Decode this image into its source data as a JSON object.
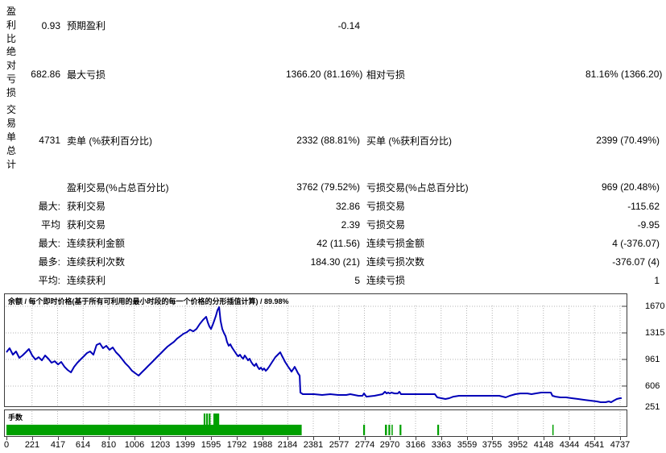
{
  "stats_table": {
    "rows": [
      {
        "group": "盈利比",
        "col2": "0.93",
        "col3": "预期盈利",
        "col4": "-0.14",
        "col5": "",
        "col6": ""
      },
      {
        "group": "绝对亏损",
        "col2": "682.86",
        "col3": "最大亏损",
        "col4": "1366.20 (81.16%)",
        "col5": "相对亏损",
        "col6": "81.16% (1366.20)"
      },
      {
        "group": "交易单总计",
        "col2": "4731",
        "col3": "卖单 (%获利百分比)",
        "col4": "2332 (88.81%)",
        "col5": "买单 (%获利百分比)",
        "col6": "2399 (70.49%)"
      },
      {
        "group": "",
        "col2": "",
        "col3": "盈利交易(%占总百分比)",
        "col4": "3762 (79.52%)",
        "col5": "亏损交易(%占总百分比)",
        "col6": "969 (20.48%)"
      },
      {
        "group": "",
        "col2": "最大:",
        "col3": "获利交易",
        "col4": "32.86",
        "col5": "亏损交易",
        "col6": "-115.62"
      },
      {
        "group": "",
        "col2": "平均",
        "col3": "获利交易",
        "col4": "2.39",
        "col5": "亏损交易",
        "col6": "-9.95"
      },
      {
        "group": "",
        "col2": "最大:",
        "col3": "连续获利金额",
        "col4": "42 (11.56)",
        "col5": "连续亏损金额",
        "col6": "4 (-376.07)"
      },
      {
        "group": "",
        "col2": "最多:",
        "col3": "连续获利次数",
        "col4": "184.30 (21)",
        "col5": "连续亏损次数",
        "col6": "-376.07 (4)"
      },
      {
        "group": "",
        "col2": "平均:",
        "col3": "连续获利",
        "col4": "5",
        "col5": "连续亏损",
        "col6": "1"
      }
    ]
  },
  "chart_data": [
    {
      "type": "line",
      "title": "余额 / 每个即时价格(基于所有可利用的最小时段的每一个价格的分形插值计算) / 89.98%",
      "line_color": "#0000b8",
      "grid": "dashed",
      "legend_position": "none",
      "xlim": [
        0,
        4860
      ],
      "ylim": [
        336,
        1842
      ],
      "x_ticks": [
        0,
        221,
        417,
        614,
        810,
        1006,
        1203,
        1399,
        1595,
        1792,
        1988,
        2184,
        2381,
        2577,
        2774,
        2970,
        3166,
        3363,
        3559,
        3755,
        3952,
        4148,
        4344,
        4541,
        4737
      ],
      "y_ticks": [
        1670,
        1315,
        961,
        606,
        251
      ],
      "series": [
        {
          "name": "余额",
          "points": [
            [
              0,
              1057
            ],
            [
              25,
              1111
            ],
            [
              51,
              1025
            ],
            [
              76,
              1068
            ],
            [
              102,
              982
            ],
            [
              127,
              1014
            ],
            [
              153,
              1057
            ],
            [
              178,
              1100
            ],
            [
              204,
              1014
            ],
            [
              229,
              960
            ],
            [
              255,
              992
            ],
            [
              280,
              949
            ],
            [
              306,
              1014
            ],
            [
              331,
              971
            ],
            [
              357,
              917
            ],
            [
              382,
              938
            ],
            [
              408,
              895
            ],
            [
              433,
              928
            ],
            [
              459,
              863
            ],
            [
              484,
              820
            ],
            [
              510,
              788
            ],
            [
              535,
              863
            ],
            [
              561,
              917
            ],
            [
              586,
              960
            ],
            [
              612,
              1003
            ],
            [
              637,
              1046
            ],
            [
              662,
              1068
            ],
            [
              688,
              1025
            ],
            [
              713,
              1154
            ],
            [
              739,
              1175
            ],
            [
              764,
              1111
            ],
            [
              790,
              1143
            ],
            [
              815,
              1089
            ],
            [
              841,
              1121
            ],
            [
              866,
              1057
            ],
            [
              892,
              1014
            ],
            [
              917,
              960
            ],
            [
              943,
              906
            ],
            [
              968,
              863
            ],
            [
              994,
              809
            ],
            [
              1019,
              777
            ],
            [
              1045,
              745
            ],
            [
              1070,
              788
            ],
            [
              1096,
              831
            ],
            [
              1121,
              874
            ],
            [
              1147,
              917
            ],
            [
              1172,
              960
            ],
            [
              1197,
              1003
            ],
            [
              1223,
              1046
            ],
            [
              1248,
              1089
            ],
            [
              1274,
              1132
            ],
            [
              1299,
              1164
            ],
            [
              1325,
              1196
            ],
            [
              1350,
              1239
            ],
            [
              1376,
              1272
            ],
            [
              1401,
              1304
            ],
            [
              1427,
              1325
            ],
            [
              1452,
              1358
            ],
            [
              1478,
              1336
            ],
            [
              1503,
              1368
            ],
            [
              1529,
              1433
            ],
            [
              1554,
              1487
            ],
            [
              1580,
              1530
            ],
            [
              1593,
              1454
            ],
            [
              1605,
              1401
            ],
            [
              1618,
              1368
            ],
            [
              1631,
              1422
            ],
            [
              1643,
              1475
            ],
            [
              1656,
              1540
            ],
            [
              1669,
              1616
            ],
            [
              1682,
              1659
            ],
            [
              1694,
              1475
            ],
            [
              1707,
              1368
            ],
            [
              1720,
              1315
            ],
            [
              1733,
              1272
            ],
            [
              1745,
              1196
            ],
            [
              1758,
              1143
            ],
            [
              1771,
              1164
            ],
            [
              1784,
              1121
            ],
            [
              1796,
              1089
            ],
            [
              1809,
              1057
            ],
            [
              1822,
              1025
            ],
            [
              1834,
              1003
            ],
            [
              1847,
              1025
            ],
            [
              1860,
              992
            ],
            [
              1873,
              971
            ],
            [
              1885,
              1014
            ],
            [
              1898,
              982
            ],
            [
              1911,
              949
            ],
            [
              1924,
              971
            ],
            [
              1936,
              928
            ],
            [
              1949,
              895
            ],
            [
              1962,
              874
            ],
            [
              1975,
              906
            ],
            [
              1987,
              863
            ],
            [
              2000,
              831
            ],
            [
              2013,
              852
            ],
            [
              2026,
              820
            ],
            [
              2038,
              842
            ],
            [
              2051,
              809
            ],
            [
              2064,
              831
            ],
            [
              2077,
              863
            ],
            [
              2089,
              895
            ],
            [
              2102,
              928
            ],
            [
              2115,
              960
            ],
            [
              2127,
              992
            ],
            [
              2140,
              1014
            ],
            [
              2153,
              1036
            ],
            [
              2166,
              1057
            ],
            [
              2178,
              1014
            ],
            [
              2191,
              971
            ],
            [
              2204,
              928
            ],
            [
              2217,
              895
            ],
            [
              2229,
              863
            ],
            [
              2242,
              831
            ],
            [
              2255,
              798
            ],
            [
              2268,
              831
            ],
            [
              2280,
              863
            ],
            [
              2293,
              820
            ],
            [
              2306,
              777
            ],
            [
              2319,
              745
            ],
            [
              2325,
              519
            ],
            [
              2344,
              498
            ],
            [
              2433,
              498
            ],
            [
              2497,
              487
            ],
            [
              2561,
              498
            ],
            [
              2624,
              487
            ],
            [
              2688,
              487
            ],
            [
              2720,
              498
            ],
            [
              2752,
              487
            ],
            [
              2784,
              476
            ],
            [
              2816,
              476
            ],
            [
              2828,
              508
            ],
            [
              2847,
              465
            ],
            [
              2911,
              476
            ],
            [
              2975,
              498
            ],
            [
              2994,
              530
            ],
            [
              3007,
              508
            ],
            [
              3019,
              519
            ],
            [
              3032,
              508
            ],
            [
              3045,
              519
            ],
            [
              3070,
              508
            ],
            [
              3096,
              508
            ],
            [
              3108,
              530
            ],
            [
              3121,
              498
            ],
            [
              3198,
              498
            ],
            [
              3293,
              498
            ],
            [
              3389,
              498
            ],
            [
              3408,
              455
            ],
            [
              3440,
              444
            ],
            [
              3472,
              433
            ],
            [
              3503,
              444
            ],
            [
              3535,
              465
            ],
            [
              3580,
              476
            ],
            [
              3644,
              476
            ],
            [
              3771,
              476
            ],
            [
              3898,
              476
            ],
            [
              3949,
              455
            ],
            [
              3981,
              476
            ],
            [
              4026,
              498
            ],
            [
              4064,
              508
            ],
            [
              4121,
              508
            ],
            [
              4153,
              498
            ],
            [
              4185,
              508
            ],
            [
              4230,
              519
            ],
            [
              4281,
              519
            ],
            [
              4306,
              519
            ],
            [
              4319,
              476
            ],
            [
              4344,
              465
            ],
            [
              4382,
              455
            ],
            [
              4427,
              455
            ],
            [
              4471,
              444
            ],
            [
              4522,
              433
            ],
            [
              4573,
              422
            ],
            [
              4624,
              411
            ],
            [
              4669,
              401
            ],
            [
              4701,
              390
            ],
            [
              4739,
              390
            ],
            [
              4764,
              401
            ],
            [
              4783,
              390
            ],
            [
              4803,
              411
            ],
            [
              4828,
              433
            ],
            [
              4854,
              444
            ],
            [
              4866,
              444
            ]
          ]
        }
      ]
    },
    {
      "type": "bar",
      "title": "手数",
      "bar_color": "#00a000",
      "ymax": 1,
      "bars": [
        [
          0,
          2335,
          0.45
        ],
        [
          1560,
          14,
          0.93
        ],
        [
          1580,
          14,
          0.93
        ],
        [
          1600,
          14,
          0.93
        ],
        [
          1637,
          46,
          0.93
        ],
        [
          2822,
          14,
          0.45
        ],
        [
          2994,
          16,
          0.45
        ],
        [
          3021,
          14,
          0.45
        ],
        [
          3046,
          7,
          0.45
        ],
        [
          3110,
          14,
          0.45
        ],
        [
          3408,
          14,
          0.45
        ],
        [
          4318,
          9,
          0.45
        ]
      ]
    }
  ]
}
